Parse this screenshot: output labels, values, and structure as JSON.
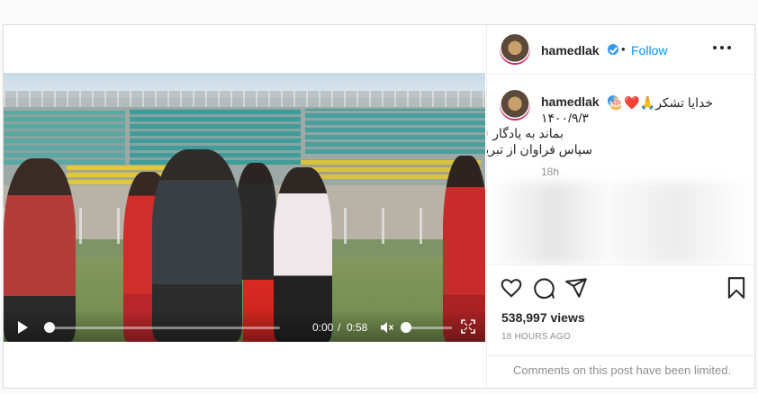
{
  "video": {
    "current_time": "0:00",
    "separator": "/",
    "duration": "0:58"
  },
  "post": {
    "username": "hamedlak",
    "follow_label": "Follow",
    "dot": "•",
    "caption": {
      "line1": "خدایا تشکر🙏❤️🎂",
      "line2": "۱۴۰۰/۹/۳",
      "line3": "بماند به یادگار 😍😟",
      "line4": "سپاس فراوان از تبریک هاتون❤️"
    },
    "caption_time": "18h",
    "views": "538,997 views",
    "posted_ago": "18 HOURS AGO",
    "comments_limited": "Comments on this post have been limited."
  },
  "colors": {
    "accent": "#0095f6",
    "verified": "#3897f0",
    "muted_text": "#8e8e8e",
    "border": "#dbdbdb"
  },
  "icons": {
    "play": "play-icon",
    "volume": "volume-icon",
    "fullscreen": "fullscreen-icon",
    "more": "more-icon",
    "like": "heart-icon",
    "comment": "comment-icon",
    "share": "share-icon",
    "save": "bookmark-icon"
  }
}
